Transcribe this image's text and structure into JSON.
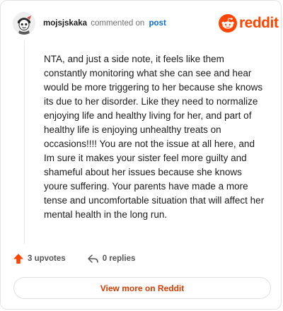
{
  "header": {
    "username": "mojsjskaka",
    "action_text": "commented on",
    "post_link": "post",
    "brand_name": "reddit"
  },
  "comment": {
    "body": "NTA, and just a side note, it feels like them constantly monitoring what she can see and hear would be more triggering to her because she knows its due to her disorder. Like they need to normalize enjoying life and healthy living for her, and part of healthy life is enjoying unhealthy treats on occasions!!!! You are not the issue at all here, and Im sure it makes your sister feel more guilty and shameful about her issues because she knows youre suffering. Your parents have made a more tense and uncomfortable situation that will affect her mental health in the long run."
  },
  "actions": {
    "upvotes_label": "3 upvotes",
    "replies_label": "0 replies"
  },
  "footer": {
    "view_more_label": "View more on Reddit"
  },
  "icons": {
    "brand_logo": "reddit-snoo-icon",
    "upvote": "upvote-arrow-icon",
    "reply": "reply-arrow-icon"
  },
  "colors": {
    "brand": "#ff4500",
    "upvote": "#ff4500",
    "link": "#0a6bd8",
    "view_more_text": "#d93a00"
  }
}
